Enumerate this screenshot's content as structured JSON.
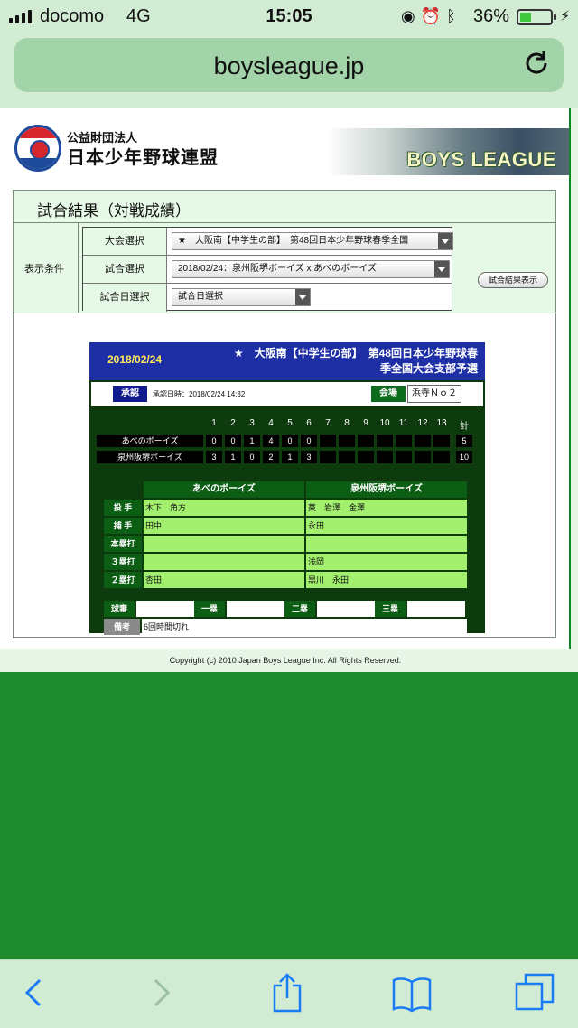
{
  "status_bar": {
    "carrier": "docomo",
    "network": "4G",
    "time": "15:05",
    "battery": "36%"
  },
  "browser": {
    "url": "boysleague.jp"
  },
  "header": {
    "org_small": "公益財団法人",
    "org_name": "日本少年野球連盟",
    "banner_text": "BOYS LEAGUE"
  },
  "result": {
    "title": "試合結果（対戦成績）",
    "condition_label": "表示条件",
    "filters": [
      {
        "label": "大会選択",
        "value": "★　大阪南【中学生の部】　第48回日本少年野球春季全国"
      },
      {
        "label": "試合選択",
        "value": "2018/02/24：泉州阪堺ボーイズ x あべのボーイズ"
      },
      {
        "label": "試合日選択",
        "value": "試合日選択"
      }
    ],
    "show_button": "試合結果表示"
  },
  "game": {
    "date": "2018/02/24",
    "tournament_line1": "★　大阪南【中学生の部】　第48回日本少年野球春",
    "tournament_line2": "季全国大会支部予選",
    "approval_label": "承認",
    "approval_date": "承認日時：2018/02/24 14:32",
    "venue_label": "会場",
    "venue": "浜寺Ｎｏ２",
    "innings": [
      "1",
      "2",
      "3",
      "4",
      "5",
      "6",
      "7",
      "8",
      "9",
      "10",
      "11",
      "12",
      "13"
    ],
    "total_label": "計",
    "teams": [
      {
        "name": "あべのボーイズ",
        "scores": [
          "0",
          "0",
          "1",
          "4",
          "0",
          "0",
          "",
          "",
          "",
          "",
          "",
          "",
          ""
        ],
        "total": "5"
      },
      {
        "name": "泉州阪堺ボーイズ",
        "scores": [
          "3",
          "1",
          "0",
          "2",
          "1",
          "3",
          "",
          "",
          "",
          "",
          "",
          "",
          ""
        ],
        "total": "10"
      }
    ],
    "detail_headers": [
      "あべのボーイズ",
      "泉州阪堺ボーイズ"
    ],
    "details": [
      {
        "label": "投 手",
        "left": "木下　角方",
        "right": "藁　岩澤　金澤"
      },
      {
        "label": "捕 手",
        "left": "田中",
        "right": "永田"
      },
      {
        "label": "本塁打",
        "left": "",
        "right": ""
      },
      {
        "label": "３塁打",
        "left": "",
        "right": "浅岡"
      },
      {
        "label": "２塁打",
        "left": "杏田",
        "right": "黒川　永田"
      }
    ],
    "umpires": [
      {
        "label": "球審",
        "value": ""
      },
      {
        "label": "一塁",
        "value": ""
      },
      {
        "label": "二塁",
        "value": ""
      },
      {
        "label": "三塁",
        "value": ""
      }
    ],
    "note_label": "備考",
    "note": "6回時間切れ"
  },
  "footer": {
    "copyright": "Copyright (c) 2010 Japan Boys League Inc. All Rights Reserved."
  },
  "toolbar": {
    "icons": [
      "back-icon",
      "forward-icon",
      "share-icon",
      "bookmarks-icon",
      "tabs-icon"
    ]
  },
  "colors": {
    "brand_green": "#1e8b2e",
    "board_bg": "#0d3b0d",
    "board_header": "#1e2fa6",
    "cell_green": "#a3f06e",
    "accent_blue": "#1a7cf5"
  }
}
